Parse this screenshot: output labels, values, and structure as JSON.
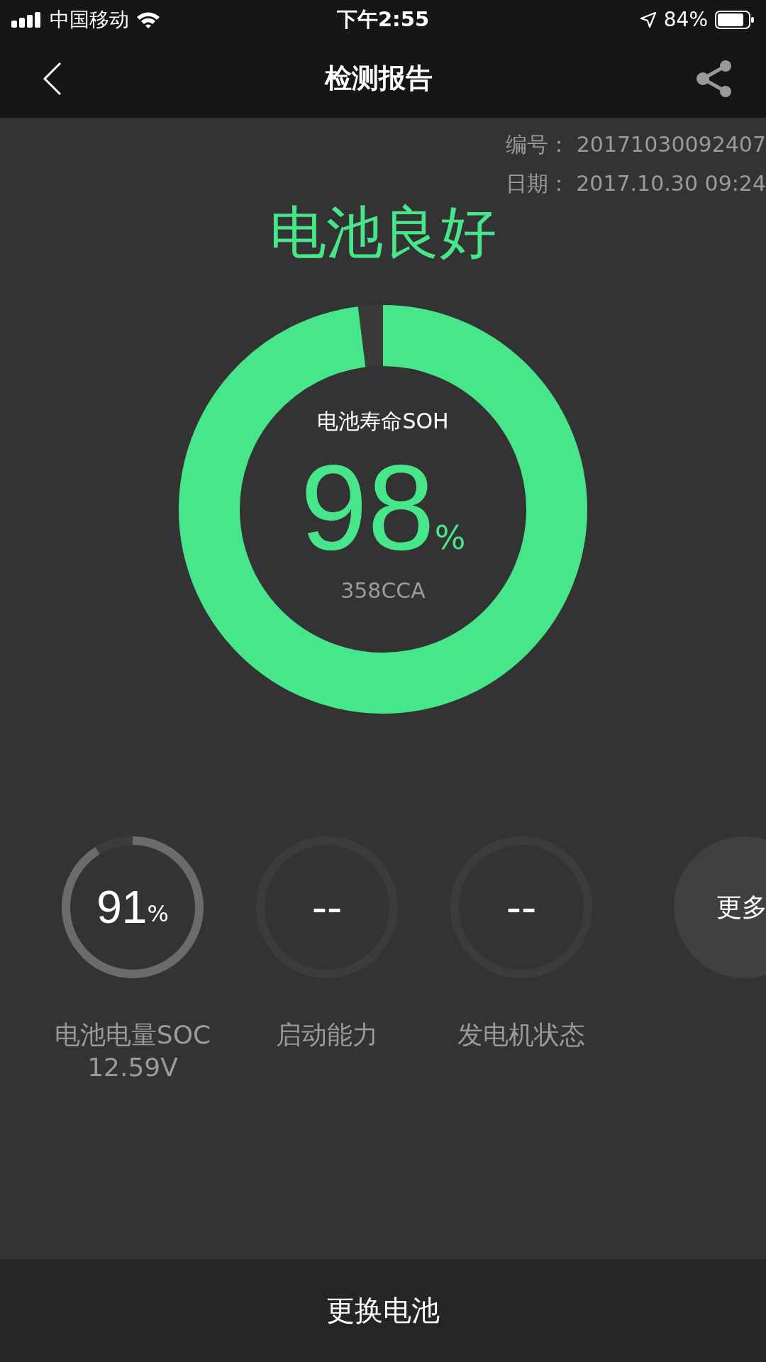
{
  "status_bar": {
    "carrier": "中国移动",
    "time": "下午2:55",
    "battery_text": "84%"
  },
  "nav": {
    "title": "检测报告"
  },
  "report": {
    "number_label": "编号：",
    "number": "20171030092407",
    "date_label": "日期：",
    "date": "2017.10.30 09:24"
  },
  "verdict": "电池良好",
  "soh": {
    "label": "电池寿命SOH",
    "value": "98",
    "unit": "%",
    "level": 0.98,
    "cca": "358CCA"
  },
  "gauges": [
    {
      "kind": "ring",
      "value": "91",
      "unit": "%",
      "level": 0.91,
      "caption": "电池电量SOC",
      "sub": "12.59V"
    },
    {
      "kind": "ring",
      "value": "--",
      "caption": "启动能力"
    },
    {
      "kind": "ring",
      "value": "--",
      "caption": "发电机状态"
    },
    {
      "kind": "more",
      "label": "更多"
    }
  ],
  "bottom_button": "更换电池"
}
